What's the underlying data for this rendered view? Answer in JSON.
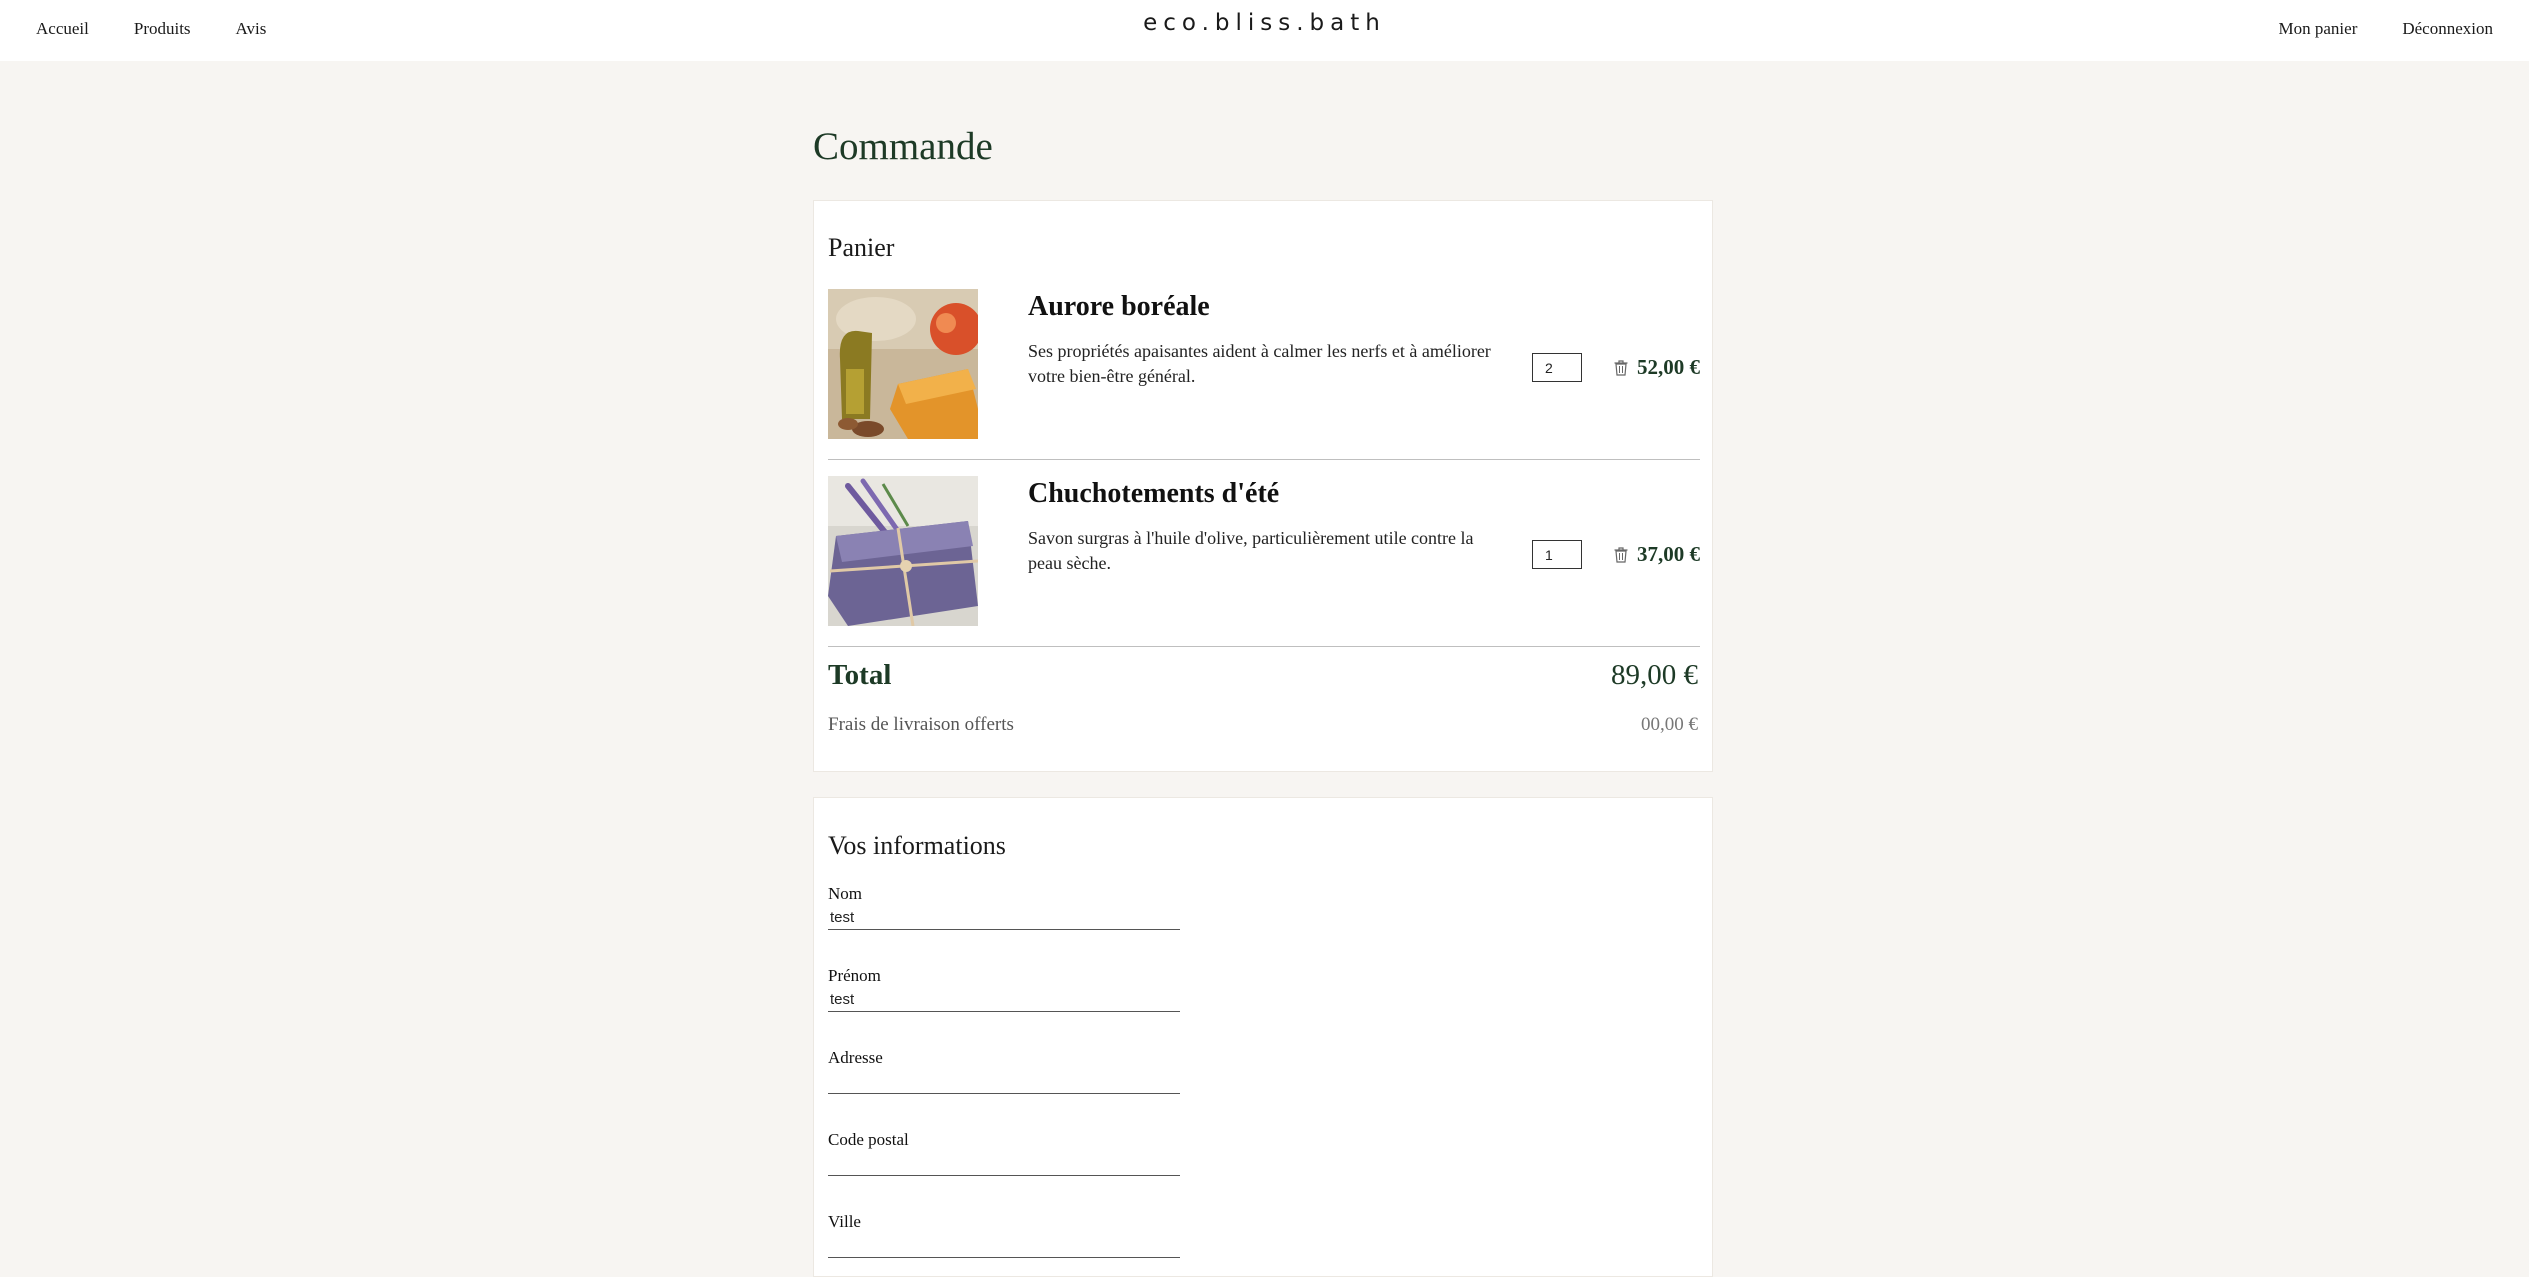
{
  "nav": {
    "home": "Accueil",
    "products": "Produits",
    "reviews": "Avis",
    "brand": "eco.bliss.bath",
    "cart": "Mon panier",
    "logout": "Déconnexion"
  },
  "page": {
    "title": "Commande"
  },
  "cart": {
    "title": "Panier",
    "items": [
      {
        "name": "Aurore boréale",
        "description": "Ses propriétés apaisantes aident à calmer les nerfs et à améliorer votre bien-être général.",
        "quantity": "2",
        "price": "52,00 €",
        "image_icon": "soap-orange-image"
      },
      {
        "name": "Chuchotements d'été",
        "description": "Savon surgras à l'huile d'olive, particulièrement utile contre la peau sèche.",
        "quantity": "1",
        "price": "37,00 €",
        "image_icon": "soap-lavender-image"
      }
    ],
    "total_label": "Total",
    "total_value": "89,00 €",
    "shipping_label": "Frais de livraison offerts",
    "shipping_value": "00,00 €"
  },
  "info": {
    "title": "Vos informations",
    "fields": [
      {
        "label": "Nom",
        "value": "test"
      },
      {
        "label": "Prénom",
        "value": "test"
      },
      {
        "label": "Adresse",
        "value": ""
      },
      {
        "label": "Code postal",
        "value": ""
      },
      {
        "label": "Ville",
        "value": ""
      }
    ]
  },
  "colors": {
    "background": "#f7f5f2",
    "accent_green": "#1d3a26",
    "card": "#ffffff"
  }
}
